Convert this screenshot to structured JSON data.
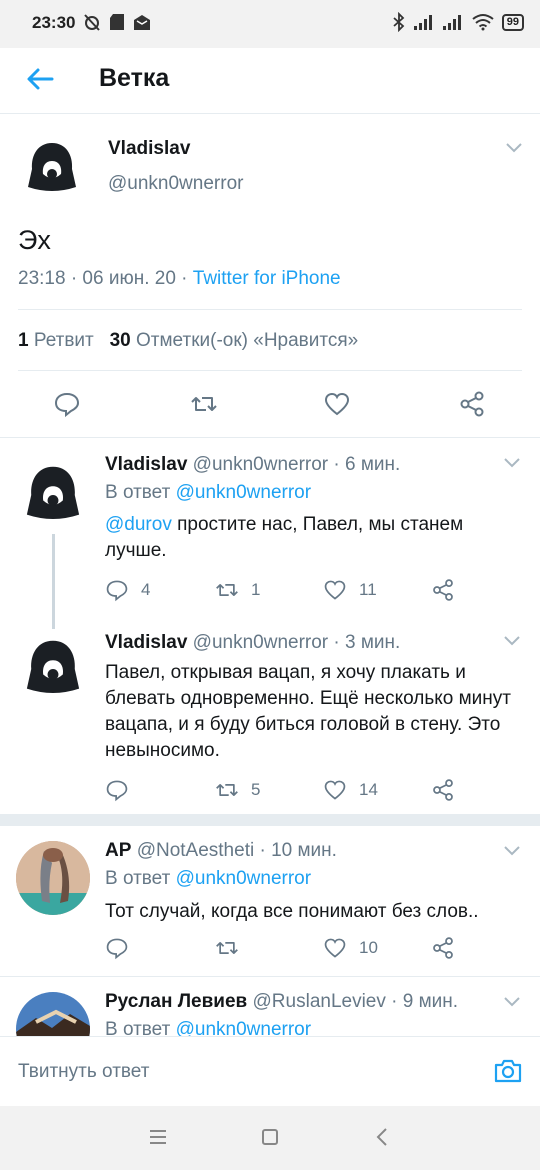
{
  "status": {
    "time": "23:30",
    "battery": "99"
  },
  "header": {
    "title": "Ветка"
  },
  "main_tweet": {
    "name": "Vladislav",
    "handle": "@unkn0wnerror",
    "text": "Эх",
    "meta_time": "23:18 · 06 июн. 20 · ",
    "source": "Twitter for iPhone",
    "retweets_count": "1",
    "retweets_label": "Ретвит",
    "likes_count": "30",
    "likes_label": "Отметки(-ок) «Нравится»"
  },
  "replies": [
    {
      "name": "Vladislav",
      "handle_time": "@unkn0wnerror · 6 мин.",
      "in_reply_label": "В ответ ",
      "in_reply_to": "@unkn0wnerror",
      "mention": "@durov",
      "text": " простите нас, Павел, мы станем лучше.",
      "replies": "4",
      "retweets": "1",
      "likes": "11"
    },
    {
      "name": "Vladislav",
      "handle_time": "@unkn0wnerror · 3 мин.",
      "text": "Павел, открывая вацап, я хочу плакать и блевать одновременно. Ещё несколько минут вацапа, и я буду биться головой в стену. Это невыносимо.",
      "replies": "",
      "retweets": "5",
      "likes": "14"
    },
    {
      "name": "AP",
      "handle_time": "@NotAesthetі · 10 мин.",
      "in_reply_label": "В ответ ",
      "in_reply_to": "@unkn0wnerror",
      "text": "Тот случай, когда все понимают без слов..",
      "replies": "",
      "retweets": "",
      "likes": "10"
    },
    {
      "name": "Руслан Левиев",
      "handle_time": "@RuslanLeviev · 9 мин.",
      "in_reply_label": "В ответ ",
      "in_reply_to": "@unkn0wnerror"
    }
  ],
  "composer": {
    "placeholder": "Твитнуть ответ"
  },
  "colors": {
    "accent": "#1da1f2",
    "secondary_text": "#657786",
    "divider": "#e6ecf0"
  },
  "icons": [
    "back-arrow-icon",
    "reply-icon",
    "retweet-icon",
    "like-icon",
    "share-icon",
    "chevron-down-icon",
    "camera-icon"
  ]
}
